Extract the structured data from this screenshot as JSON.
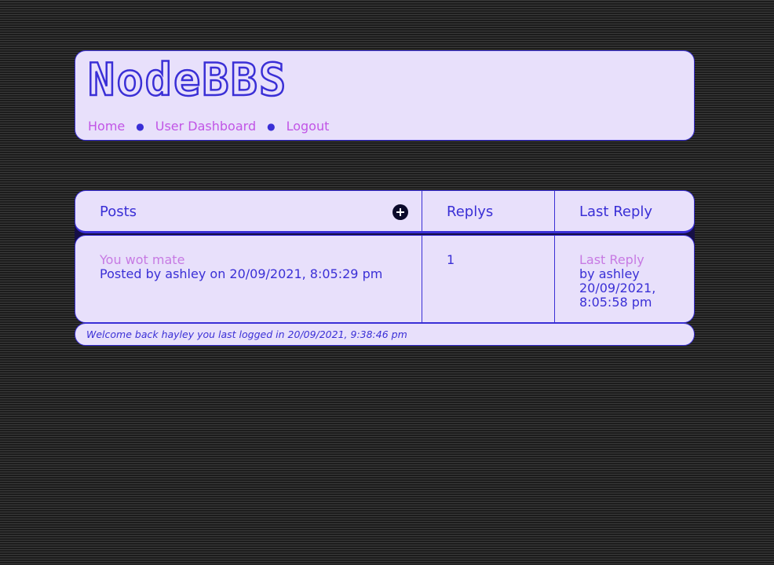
{
  "header": {
    "title": "NodeBBS",
    "nav": {
      "home": "Home",
      "dashboard": "User Dashboard",
      "logout": "Logout",
      "separator": "●"
    }
  },
  "table": {
    "headers": {
      "posts": "Posts",
      "replys": "Replys",
      "last_reply": "Last Reply"
    },
    "new_post_icon": "plus-circle-icon",
    "rows": [
      {
        "title": "You wot mate",
        "posted_by": "Posted by ashley on 20/09/2021, 8:05:29 pm",
        "replies": "1",
        "last_reply_link": "Last Reply",
        "last_reply_by": "by ashley",
        "last_reply_date": "20/09/2021,",
        "last_reply_time": "8:05:58 pm"
      }
    ]
  },
  "footer": {
    "welcome": "Welcome back hayley you last logged in 20/09/2021, 9:38:46 pm"
  },
  "colors": {
    "accent": "#3a2fd6",
    "link": "#c155e6",
    "panel": "#e8e0fb"
  }
}
